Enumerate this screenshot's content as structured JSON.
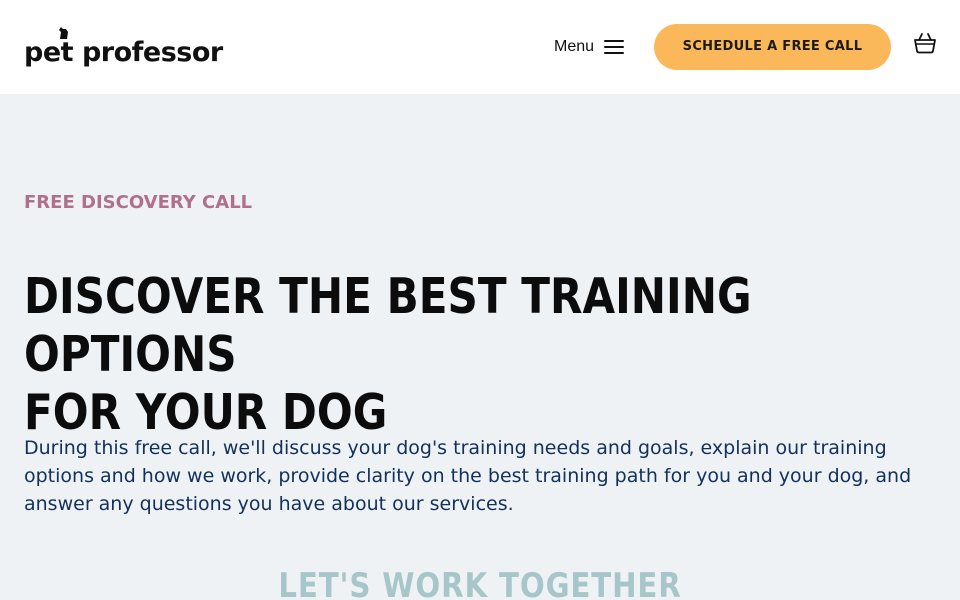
{
  "header": {
    "logo_text": "pet professor",
    "menu_label": "Menu",
    "cta_label": "SCHEDULE A FREE CALL",
    "icons": {
      "menu": "hamburger-icon",
      "cart": "cart-icon"
    }
  },
  "hero": {
    "eyebrow": "FREE DISCOVERY CALL",
    "headline_line1": "DISCOVER THE BEST TRAINING OPTIONS",
    "headline_line2": "FOR YOUR DOG",
    "body": "During this free call, we'll discuss your dog's training needs and goals, explain our training options and how we work, provide clarity on the best training path for you and your dog, and answer any questions you have about our services."
  },
  "section": {
    "subhead": "LET'S WORK TOGETHER"
  },
  "colors": {
    "accent": "#fbb85a",
    "eyebrow": "#b0708d",
    "body_text": "#12305a",
    "subhead": "#a7c6c9",
    "background": "#eef2f5"
  }
}
